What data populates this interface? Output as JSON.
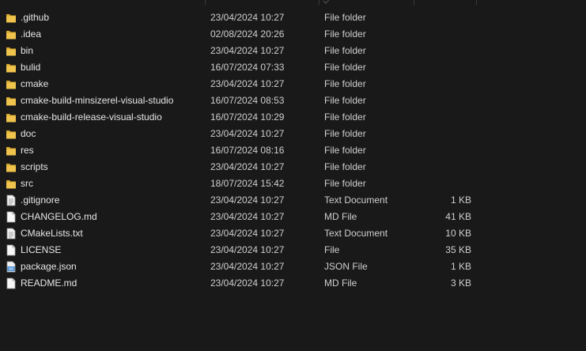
{
  "files": [
    {
      "name": ".github",
      "date": "23/04/2024 10:27",
      "type": "File folder",
      "size": "",
      "icon": "folder-icon"
    },
    {
      "name": ".idea",
      "date": "02/08/2024 20:26",
      "type": "File folder",
      "size": "",
      "icon": "folder-icon"
    },
    {
      "name": "bin",
      "date": "23/04/2024 10:27",
      "type": "File folder",
      "size": "",
      "icon": "folder-icon"
    },
    {
      "name": "bulid",
      "date": "16/07/2024 07:33",
      "type": "File folder",
      "size": "",
      "icon": "folder-icon"
    },
    {
      "name": "cmake",
      "date": "23/04/2024 10:27",
      "type": "File folder",
      "size": "",
      "icon": "folder-icon"
    },
    {
      "name": "cmake-build-minsizerel-visual-studio",
      "date": "16/07/2024 08:53",
      "type": "File folder",
      "size": "",
      "icon": "folder-icon"
    },
    {
      "name": "cmake-build-release-visual-studio",
      "date": "16/07/2024 10:29",
      "type": "File folder",
      "size": "",
      "icon": "folder-icon"
    },
    {
      "name": "doc",
      "date": "23/04/2024 10:27",
      "type": "File folder",
      "size": "",
      "icon": "folder-icon"
    },
    {
      "name": "res",
      "date": "16/07/2024 08:16",
      "type": "File folder",
      "size": "",
      "icon": "folder-icon"
    },
    {
      "name": "scripts",
      "date": "23/04/2024 10:27",
      "type": "File folder",
      "size": "",
      "icon": "folder-icon"
    },
    {
      "name": "src",
      "date": "18/07/2024 15:42",
      "type": "File folder",
      "size": "",
      "icon": "folder-icon"
    },
    {
      "name": ".gitignore",
      "date": "23/04/2024 10:27",
      "type": "Text Document",
      "size": "1 KB",
      "icon": "text-document-icon"
    },
    {
      "name": "CHANGELOG.md",
      "date": "23/04/2024 10:27",
      "type": "MD File",
      "size": "41 KB",
      "icon": "file-icon"
    },
    {
      "name": "CMakeLists.txt",
      "date": "23/04/2024 10:27",
      "type": "Text Document",
      "size": "10 KB",
      "icon": "text-document-icon"
    },
    {
      "name": "LICENSE",
      "date": "23/04/2024 10:27",
      "type": "File",
      "size": "35 KB",
      "icon": "file-icon"
    },
    {
      "name": "package.json",
      "date": "23/04/2024 10:27",
      "type": "JSON File",
      "size": "1 KB",
      "icon": "json-file-icon"
    },
    {
      "name": "README.md",
      "date": "23/04/2024 10:27",
      "type": "MD File",
      "size": "3 KB",
      "icon": "file-icon"
    }
  ],
  "colors": {
    "background": "#191919",
    "text": "#e6e6e6",
    "folder": "#f0c44c",
    "folder_dark": "#d9a830"
  }
}
